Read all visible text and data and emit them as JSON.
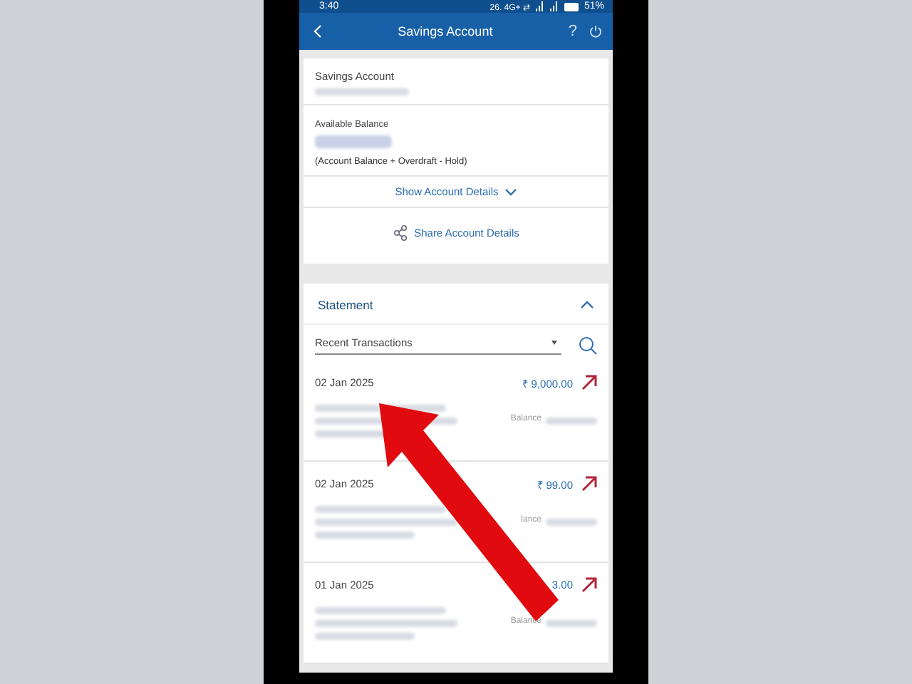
{
  "status_bar": {
    "time": "3:40",
    "network": "26. 4G+ ⇄",
    "battery": "51%"
  },
  "header": {
    "title": "Savings Account",
    "help": "?"
  },
  "account_card": {
    "account_label": "Savings Account",
    "balance_label": "Available Balance",
    "balance_note": "(Account Balance + Overdraft - Hold)",
    "show_details": "Show Account Details",
    "share": "Share Account Details"
  },
  "statement": {
    "title": "Statement",
    "expanded": true,
    "filter": "Recent Transactions",
    "transactions": [
      {
        "date": "02 Jan 2025",
        "amount": "₹ 9,000.00",
        "balance_label": "Balance"
      },
      {
        "date": "02 Jan 2025",
        "amount": "₹ 99.00",
        "balance_label": "lance"
      },
      {
        "date": "01 Jan 2025",
        "amount": "3.00",
        "balance_label": "Balance"
      }
    ]
  }
}
